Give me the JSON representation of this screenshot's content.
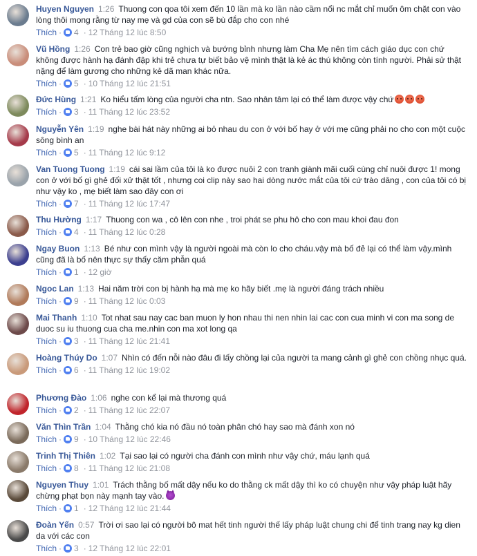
{
  "ui": {
    "like_label": "Thích",
    "dot": "·"
  },
  "comments": [
    {
      "author": "Huyen Nguyen",
      "time": "1:26",
      "text": "Thuong con qoa tôi xem đến 10 lần mà ko lần nào cầm nổi nc mắt chỉ muốn ôm chặt con vào lòng thôi mong rằng từ nay mẹ và gd của con sẽ bù đắp cho con nhé",
      "likes": "4",
      "date": "12 Tháng 12 lúc 8:50",
      "avatar_color": "#6b7c8f"
    },
    {
      "author": "Vũ Hồng",
      "time": "1:26",
      "text": "Con trẻ bao giờ cũng nghịch và bướng bỉnh nhưng làm Cha Mẹ nên tìm cách giáo dục con chứ không được hành hạ đánh đập khi trẻ chưa tự biết bảo vệ mình thật là kẻ ác thú không còn tính người. Phải sử thật nặng để làm gương cho những kẻ dã man khác nữa.",
      "likes": "5",
      "date": "10 Tháng 12 lúc 21:51",
      "avatar_color": "#c98d7a"
    },
    {
      "author": "Đức Hùng",
      "time": "1:21",
      "text": "Ko hiểu tấm lòng của người cha ntn. Sao nhân tâm lại có thể làm được vậy chứ",
      "emoji": [
        "angry",
        "angry",
        "angry"
      ],
      "likes": "3",
      "date": "11 Tháng 12 lúc 23:52",
      "avatar_color": "#7d8a5c"
    },
    {
      "author": "Nguyễn Yên",
      "time": "1:19",
      "text": "nghe bài hát này những ai bỏ nhau du con ở với bố hay ở với mẹ cũng phải no cho con một cuộc sông bình an",
      "likes": "5",
      "date": "11 Tháng 12 lúc 9:12",
      "avatar_color": "#a53a4a"
    },
    {
      "author": "Van Tuong Tuong",
      "time": "1:19",
      "text": "cái sai lầm của tôi là ko được nuôi 2 con tranh giành mãi cuối cùng chỉ nuôi được 1! mong con ở với bố gì ghẻ đối xử thật tốt , nhưng coi clip này sao hai dòng nước mắt của tôi cứ trào dâng , con của tôi có bị như vậy ko , mẹ biết làm sao đây con ơi",
      "likes": "7",
      "date": "11 Tháng 12 lúc 17:47",
      "avatar_color": "#9aa3ab"
    },
    {
      "author": "Thu Hường",
      "time": "1:17",
      "text": "Thuong con wa , cô lên con nhe , troi phát se phu hô cho con mau khoi đau đon",
      "likes": "4",
      "date": "11 Tháng 12 lúc 0:28",
      "avatar_color": "#8a5a4a"
    },
    {
      "author": "Ngay Buon",
      "time": "1:13",
      "text": "Bé như con mình vậy là người ngoài mà còn lo cho cháu.vậy mà bố đẻ lại có thể làm vậy.mình cũng đã là bố nên thực sự thấy căm phẫn quá",
      "likes": "1",
      "date": "12 giờ",
      "avatar_color": "#3c3f8f"
    },
    {
      "author": "Ngoc Lan",
      "time": "1:13",
      "text": "Hai năm trời con bị hành hạ mà mẹ ko hãy biết .mẹ là người đáng trách nhiều",
      "likes": "9",
      "date": "11 Tháng 12 lúc 0:03",
      "avatar_color": "#b07a5a"
    },
    {
      "author": "Mai Thanh",
      "time": "1:10",
      "text": "Tot nhat sau nay cac ban muon ly hon nhau thi nen nhin lai cac con cua minh vi con ma song de duoc su iu thuong cua cha me.nhin con ma xot long qa",
      "likes": "3",
      "date": "11 Tháng 12 lúc 21:41",
      "avatar_color": "#6d4a4a"
    },
    {
      "author": "Hoàng Thúy Do",
      "time": "1:07",
      "text": "Nhìn có đến nỗi nào đâu đi lấy chồng lại của người ta mang cảnh gì ghẻ con chồng nhục quá.",
      "likes": "6",
      "date": "11 Tháng 12 lúc 19:02",
      "avatar_color": "#c99a7a"
    },
    {
      "author": "Phương Đào",
      "time": "1:06",
      "text": "nghe con kể lại mà thương quá",
      "likes": "2",
      "date": "11 Tháng 12 lúc 22:07",
      "avatar_color": "#c0242b"
    },
    {
      "author": "Văn Thìn Trần",
      "time": "1:04",
      "text": "Thằng chó kia nó đầu nó toàn phân chó hay sao mà đánh xon nó",
      "likes": "9",
      "date": "10 Tháng 12 lúc 22:46",
      "avatar_color": "#7a6a5a"
    },
    {
      "author": "Trinh Thị Thiên",
      "time": "1:02",
      "text": "Tại sao lại có người cha đánh con mình như vậy chứ, máu lạnh quá",
      "likes": "8",
      "date": "11 Tháng 12 lúc 21:08",
      "avatar_color": "#8a7a6a"
    },
    {
      "author": "Nguyen Thuy",
      "time": "1:01",
      "text": "Trách thằng bố mất dậy nếu ko do thằng ck mất dậy thì ko có chuyện như vậy pháp luật hãy chừng phạt bọn này mạnh tay vào.",
      "emoji": [
        "devil"
      ],
      "likes": "1",
      "date": "12 Tháng 12 lúc 21:44",
      "avatar_color": "#5a4a3a"
    },
    {
      "author": "Đoàn Yến",
      "time": "0:57",
      "text": "Trời ơi sao lại có người bô mat hết tinh người thế lấy pháp luật chung chi để tinh trang nay kg dien da với các con",
      "likes": "3",
      "date": "12 Tháng 12 lúc 22:01",
      "avatar_color": "#4a4a4a"
    }
  ]
}
